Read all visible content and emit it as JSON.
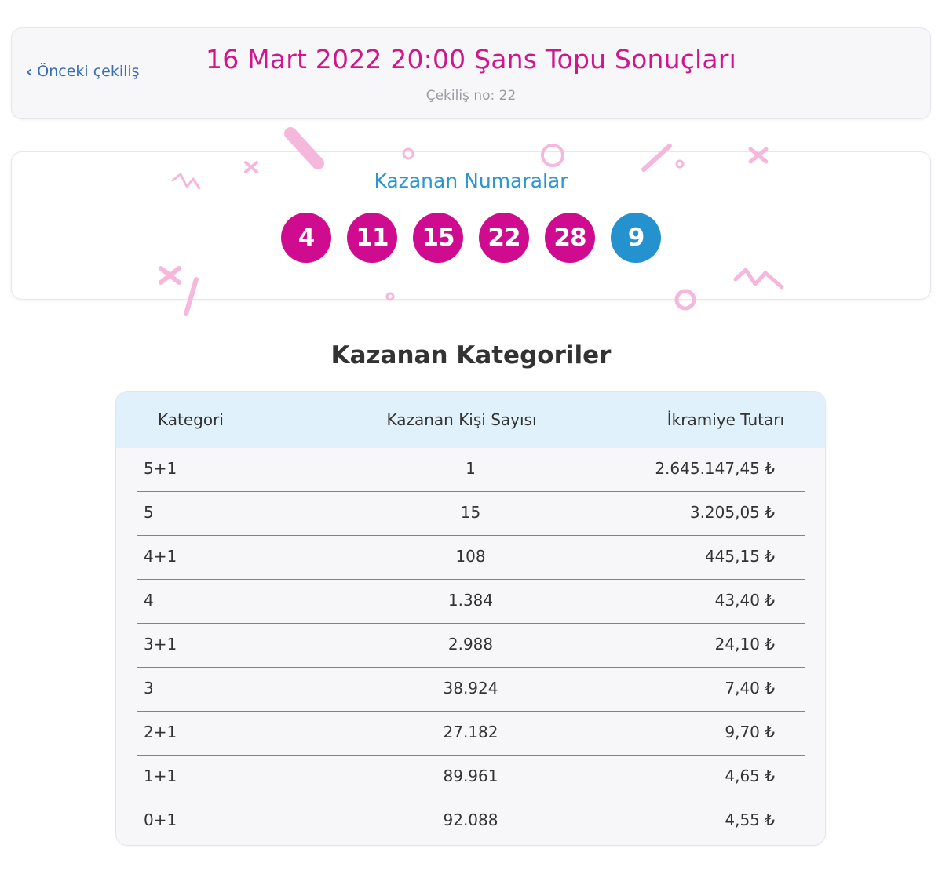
{
  "header": {
    "prev_label": "Önceki çekiliş",
    "title": "16 Mart 2022 20:00 Şans Topu Sonuçları",
    "draw_no": "Çekiliş no: 22"
  },
  "numbers": {
    "title": "Kazanan Numaralar",
    "main": [
      "4",
      "11",
      "15",
      "22",
      "28"
    ],
    "bonus": "9",
    "main_color": "#cf0c8f",
    "bonus_color": "#2592d0"
  },
  "categories": {
    "title": "Kazanan Kategoriler",
    "columns": [
      "Kategori",
      "Kazanan Kişi Sayısı",
      "İkramiye Tutarı"
    ],
    "rows": [
      [
        "5+1",
        "1",
        "2.645.147,45 ₺"
      ],
      [
        "5",
        "15",
        "3.205,05 ₺"
      ],
      [
        "4+1",
        "108",
        "445,15 ₺"
      ],
      [
        "4",
        "1.384",
        "43,40 ₺"
      ],
      [
        "3+1",
        "2.988",
        "24,10 ₺"
      ],
      [
        "3",
        "38.924",
        "7,40 ₺"
      ],
      [
        "2+1",
        "27.182",
        "9,70 ₺"
      ],
      [
        "1+1",
        "89.961",
        "4,65 ₺"
      ],
      [
        "0+1",
        "92.088",
        "4,55 ₺"
      ]
    ]
  }
}
